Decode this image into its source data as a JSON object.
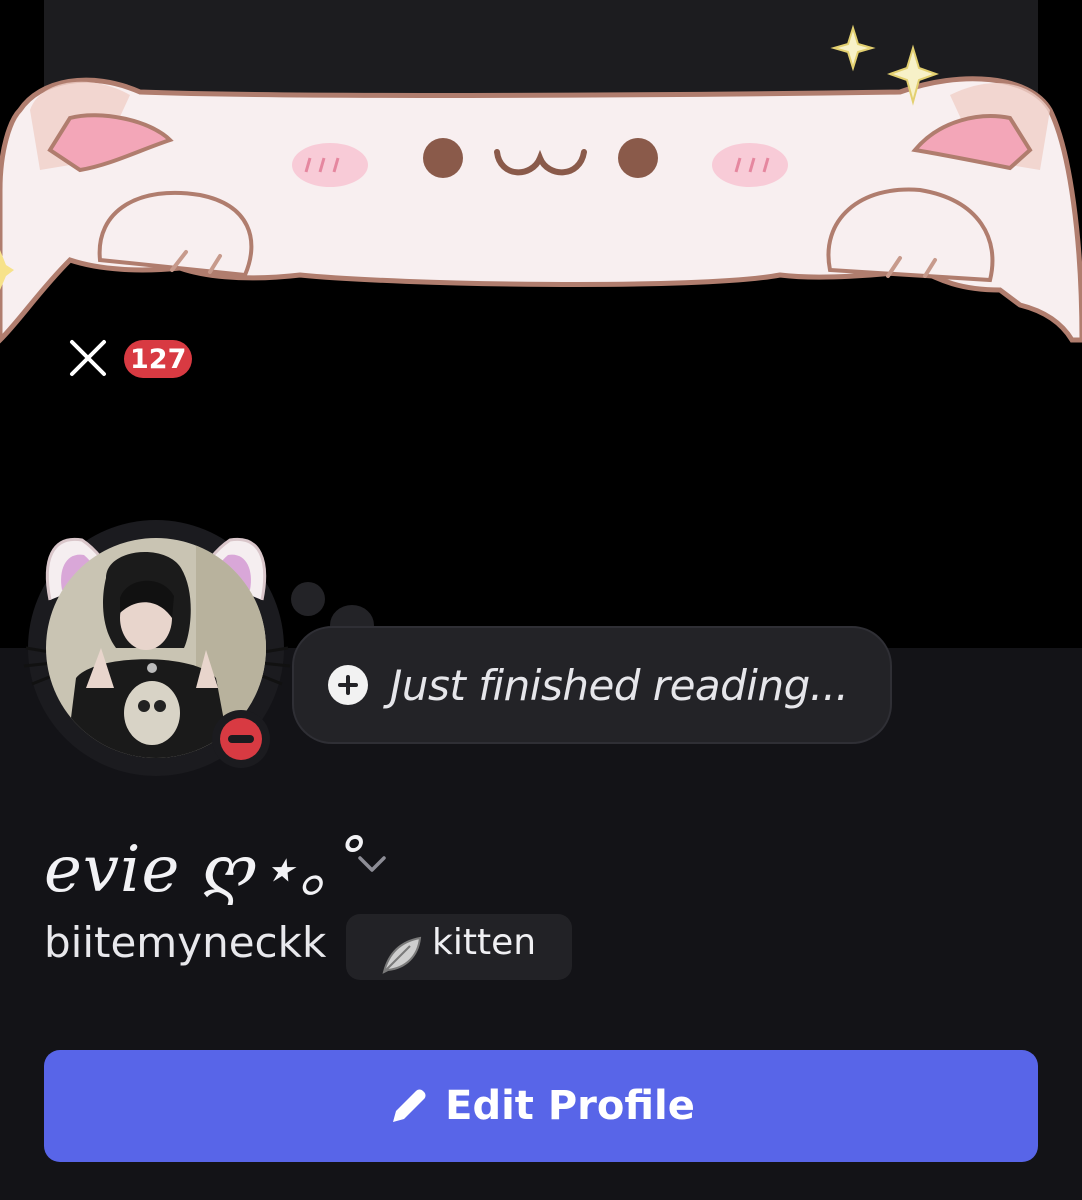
{
  "header": {
    "notification_count": "127"
  },
  "status": {
    "text": "Just finished reading..."
  },
  "profile": {
    "display_name": "evie ღ⋆｡˚",
    "username": "biitemyneckk",
    "tag": "kitten"
  },
  "actions": {
    "edit_profile_label": "Edit Profile"
  },
  "colors": {
    "accent": "#5865e8",
    "badge_red": "#d83a42",
    "panel_bg": "#131317"
  },
  "icons": {
    "close": "close-icon",
    "add": "plus-icon",
    "edit": "pencil-icon",
    "chevron": "chevron-down-icon",
    "tag": "feather-icon",
    "status": "dnd-status-icon"
  }
}
